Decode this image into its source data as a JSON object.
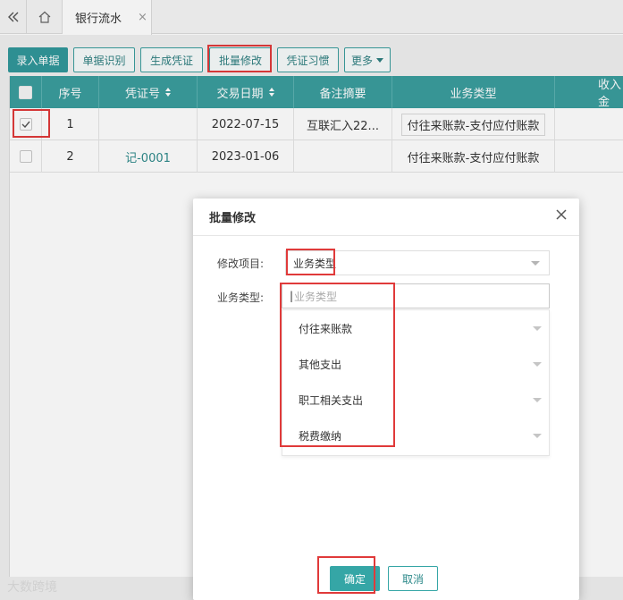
{
  "tabs": {
    "collapse_icon": "double-chevron-left-icon",
    "home_icon": "home-icon",
    "active_tab": "银行流水",
    "close_glyph": "×"
  },
  "toolbar": {
    "buttons": [
      "录入单据",
      "单据识别",
      "生成凭证",
      "批量修改",
      "凭证习惯",
      "更多"
    ]
  },
  "table": {
    "headers": [
      "序号",
      "凭证号",
      "交易日期",
      "备注摘要",
      "业务类型",
      "收入金"
    ],
    "rows": [
      {
        "seq": "1",
        "voucher": "",
        "date": "2022-07-15",
        "remark": "互联汇入22...",
        "type": "付往来账款-支付应付账款",
        "checked": true
      },
      {
        "seq": "2",
        "voucher": "记-0001",
        "date": "2023-01-06",
        "remark": "",
        "type": "付往来账款-支付应付账款",
        "checked": false
      }
    ]
  },
  "dialog": {
    "title": "批量修改",
    "field_label": "修改项目:",
    "field_value": "业务类型",
    "type_label": "业务类型:",
    "type_placeholder": "业务类型",
    "options": [
      "付往来账款",
      "其他支出",
      "职工相关支出",
      "税费缴纳"
    ],
    "ok_label": "确定",
    "cancel_label": "取消"
  },
  "watermark": "大数跨境",
  "colors": {
    "accent": "#31979a",
    "header": "#3a9d9e",
    "highlight": "#e03a3a"
  }
}
